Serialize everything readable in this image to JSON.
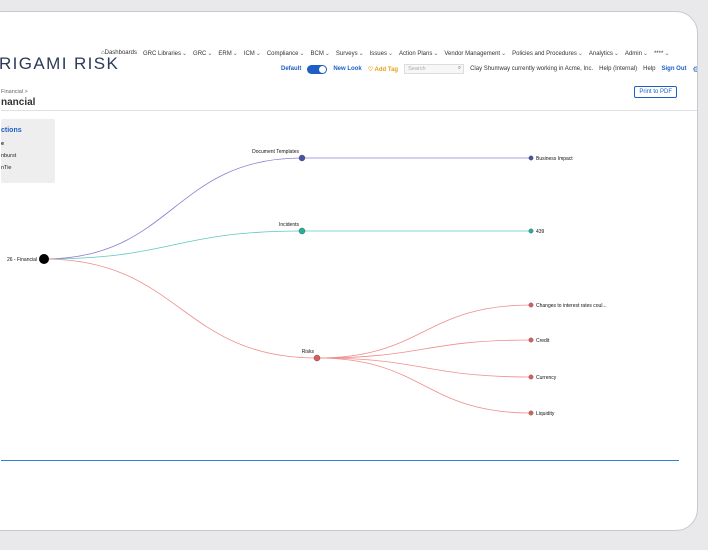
{
  "brand": {
    "logo": "RIGAMI RISK"
  },
  "nav": {
    "items": [
      "Dashboards",
      "GRC Libraries",
      "GRC",
      "ERM",
      "ICM",
      "Compliance",
      "BCM",
      "Surveys",
      "Issues",
      "Action Plans",
      "Vendor Management",
      "Policies and Procedures",
      "Analytics",
      "Admin",
      "****"
    ]
  },
  "subnav": {
    "default_label": "Default",
    "new_look_label": "New Look",
    "add_tag_label": "Add Tag",
    "search_placeholder": "Search",
    "user_text": "Clay Shumway currently working in Acme, Inc.",
    "help_internal": "Help (Internal)",
    "help": "Help",
    "sign_out": "Sign Out"
  },
  "page": {
    "breadcrumb": "Financial >",
    "title": "nancial",
    "print_button": "Print to PDF"
  },
  "panel": {
    "heading": "ctions",
    "options": [
      "e",
      "nburst",
      "nTie"
    ]
  },
  "tree": {
    "root": "26 - Financial",
    "branches": [
      {
        "label": "Document Templates",
        "color": "#4b4fa6",
        "line_color": "#8a7fcf",
        "leaves": [
          "Business Impact"
        ]
      },
      {
        "label": "Incidents",
        "color": "#1fb39c",
        "line_color": "#5cc8bc",
        "leaves": [
          "439"
        ]
      },
      {
        "label": "Risks",
        "color": "#e15b5b",
        "line_color": "#f08c8c",
        "leaves": [
          "Changes to interest rates coul...",
          "Credit",
          "Currency",
          "Liquidity"
        ]
      }
    ]
  }
}
